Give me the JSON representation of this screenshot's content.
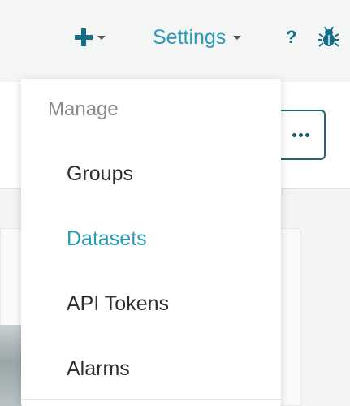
{
  "navbar": {
    "add_icon": "plus-icon",
    "settings_label": "Settings",
    "help_label": "?",
    "bug_icon": "bug-icon",
    "accent_color": "#2a9ab8",
    "dark_accent_color": "#136d84"
  },
  "toolbar": {
    "more_icon": "more-horizontal-icon"
  },
  "dropdown": {
    "header": "Manage",
    "items": [
      {
        "label": "Groups",
        "active": false
      },
      {
        "label": "Datasets",
        "active": true
      },
      {
        "label": "API Tokens",
        "active": false
      },
      {
        "label": "Alarms",
        "active": false
      }
    ]
  }
}
